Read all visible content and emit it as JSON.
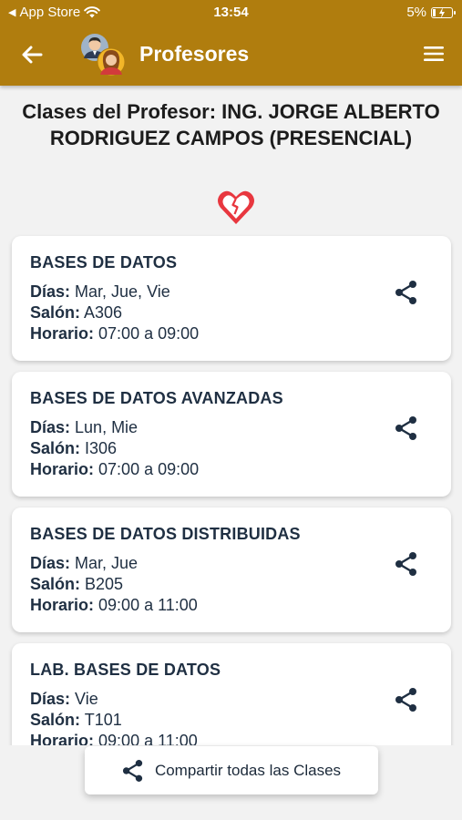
{
  "statusbar": {
    "back_app": "App Store",
    "time": "13:54",
    "battery": "5%"
  },
  "navbar": {
    "title": "Profesores"
  },
  "page": {
    "title": "Clases del Profesor: ING. JORGE ALBERTO RODRIGUEZ CAMPOS (PRESENCIAL)"
  },
  "labels": {
    "dias": "Días:",
    "salon": "Salón:",
    "horario": "Horario:"
  },
  "classes": [
    {
      "name": "BASES DE DATOS",
      "dias": "Mar, Jue, Vie",
      "salon": "A306",
      "horario": "07:00 a 09:00"
    },
    {
      "name": "BASES DE DATOS AVANZADAS",
      "dias": "Lun, Mie",
      "salon": "I306",
      "horario": "07:00 a 09:00"
    },
    {
      "name": "BASES DE DATOS DISTRIBUIDAS",
      "dias": "Mar, Jue",
      "salon": "B205",
      "horario": "09:00 a 11:00"
    },
    {
      "name": "LAB. BASES DE DATOS",
      "dias": "Vie",
      "salon": "T101",
      "horario": "09:00 a 11:00"
    }
  ],
  "bottom_button": {
    "label": "Compartir todas las Clases"
  },
  "colors": {
    "header": "#b07d0e",
    "heart": "#e8373f",
    "text": "#1f2f42"
  },
  "icons": {
    "back": "arrow-left-icon",
    "menu": "hamburger-icon",
    "share": "share-icon",
    "favorite": "broken-heart-icon"
  }
}
